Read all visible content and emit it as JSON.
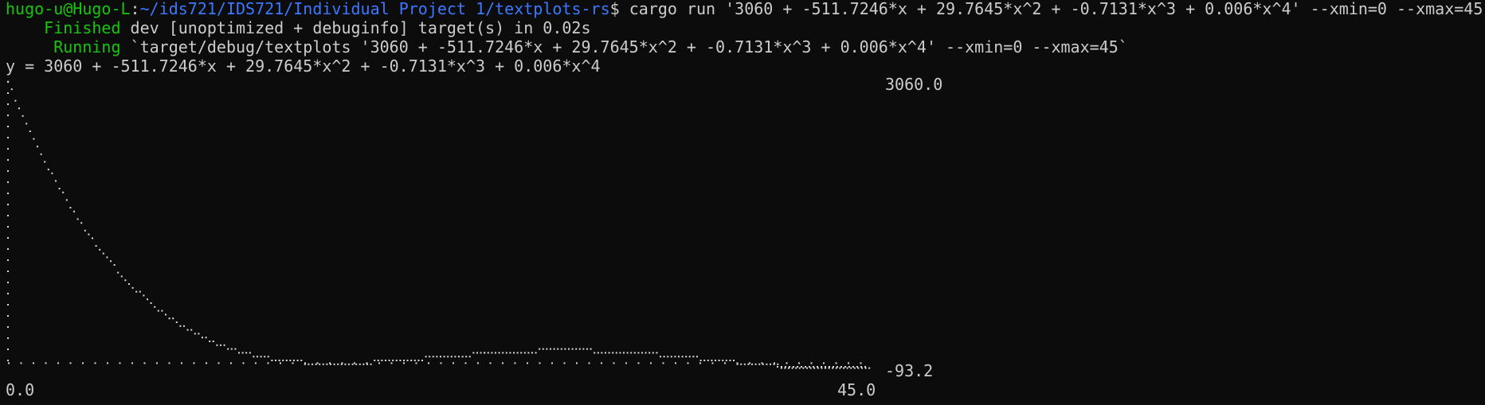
{
  "terminal": {
    "prompt_user": "hugo-u@Hugo-L",
    "prompt_sep": ":",
    "prompt_path": "~/ids721/IDS721/Individual Project 1/textplots-rs",
    "prompt_dollar": "$ ",
    "command": "cargo run '3060 + -511.7246*x + 29.7645*x^2 + -0.7131*x^3 + 0.006*x^4' --xmin=0 --xmax=45",
    "finished_word": "    Finished",
    "finished_rest": " dev [unoptimized + debuginfo] target(s) in 0.02s",
    "running_word": "     Running",
    "running_rest": " `target/debug/textplots '3060 + -511.7246*x + 29.7645*x^2 + -0.7131*x^3 + 0.006*x^4' --xmin=0 --xmax=45`",
    "equation": "y = 3060 + -511.7246*x + 29.7645*x^2 + -0.7131*x^3 + 0.006*x^4"
  },
  "colors": {
    "background": "#0c0c0c",
    "text": "#cccccc",
    "user": "#16c60c",
    "path": "#3b78ff",
    "status": "#16c60c",
    "plot_dot": "#d8d8d8"
  },
  "chart_data": {
    "type": "line",
    "function": "3060 + -511.7246*x + 29.7645*x^2 + -0.7131*x^3 + 0.006*x^4",
    "coefficients": [
      3060,
      -511.7246,
      29.7645,
      -0.7131,
      0.006
    ],
    "xlim": [
      0,
      45
    ],
    "ylim": [
      -93.2,
      3060
    ],
    "x_tick_labels": [
      "0.0",
      "45.0"
    ],
    "y_tick_labels": [
      "3060.0",
      "-93.2"
    ]
  }
}
